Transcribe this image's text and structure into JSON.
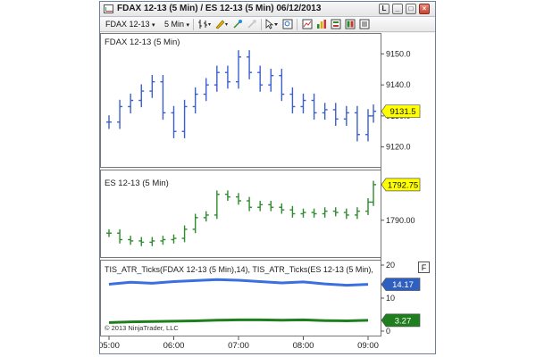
{
  "window": {
    "title": "FDAX 12-13 (5 Min) / ES 12-13 (5 Min)  06/12/2013",
    "buttons": [
      "L",
      "_",
      "□",
      "×"
    ]
  },
  "toolbar": {
    "instrument": "FDAX 12-13",
    "interval": "5 Min"
  },
  "panels": {
    "fdax": {
      "label": "FDAX 12-13 (5 Min)",
      "ticks": [
        "9150.0",
        "9140.0",
        "9130.0",
        "9120.0"
      ],
      "last_price": "9131.5",
      "color": "#3b5fcc"
    },
    "es": {
      "label": "ES 12-13 (5 Min)",
      "ticks": [
        "1790.00"
      ],
      "last_price": "1792.75",
      "color": "#2e8b2e"
    },
    "atr": {
      "label": "TIS_ATR_Ticks(FDAX 12-13 (5 Min),14), TIS_ATR_Ticks(ES 12-13 (5 Min),",
      "ticks": [
        "20",
        "10",
        "0"
      ],
      "value_blue": "14.17",
      "value_green": "3.27",
      "f_button": "F",
      "copyright": "© 2013 NinjaTrader, LLC"
    }
  },
  "time_axis": [
    "05:00",
    "06:00",
    "07:00",
    "08:00",
    "09:00"
  ],
  "chart_data": [
    {
      "type": "line",
      "title": "FDAX 12-13 (5 Min)",
      "x": [
        "05:00",
        "05:10",
        "05:20",
        "05:30",
        "05:40",
        "05:50",
        "06:00",
        "06:10",
        "06:20",
        "06:30",
        "06:40",
        "06:50",
        "07:00",
        "07:10",
        "07:20",
        "07:30",
        "07:40",
        "07:50",
        "08:00",
        "08:10",
        "08:20",
        "08:30",
        "08:40",
        "08:50",
        "09:00",
        "09:05"
      ],
      "series": [
        {
          "values": [
            9128,
            9133,
            9135,
            9138,
            9141,
            9131,
            9125,
            9133,
            9137,
            9140,
            9144,
            9141,
            9149,
            9144,
            9140,
            9143,
            9137,
            9133,
            9135,
            9131,
            9132,
            9129,
            9131,
            9124,
            9130,
            9131.5
          ]
        }
      ],
      "ylim": [
        9115,
        9155
      ]
    },
    {
      "type": "line",
      "title": "ES 12-13 (5 Min)",
      "x": [
        "05:00",
        "05:10",
        "05:20",
        "05:30",
        "05:40",
        "05:50",
        "06:00",
        "06:10",
        "06:20",
        "06:30",
        "06:40",
        "06:50",
        "07:00",
        "07:10",
        "07:20",
        "07:30",
        "07:40",
        "07:50",
        "08:00",
        "08:10",
        "08:20",
        "08:30",
        "08:40",
        "08:50",
        "09:00",
        "09:05"
      ],
      "series": [
        {
          "values": [
            1789.0,
            1788.5,
            1788.4,
            1788.3,
            1788.4,
            1788.5,
            1788.6,
            1789.3,
            1790.2,
            1790.4,
            1792.0,
            1791.8,
            1791.5,
            1791.0,
            1791.2,
            1791.0,
            1790.8,
            1790.5,
            1790.6,
            1790.5,
            1790.7,
            1790.6,
            1790.4,
            1790.7,
            1791.4,
            1792.75
          ]
        }
      ],
      "ylim": [
        1787.5,
        1793.5
      ]
    },
    {
      "type": "line",
      "title": "TIS_ATR_Ticks",
      "x": [
        "05:00",
        "05:20",
        "05:40",
        "06:00",
        "06:20",
        "06:40",
        "07:00",
        "07:20",
        "07:40",
        "08:00",
        "08:20",
        "08:40",
        "09:00"
      ],
      "series": [
        {
          "name": "TIS_ATR_Ticks(FDAX 12-13 (5 Min),14)",
          "values": [
            14.2,
            14.8,
            14.5,
            15.0,
            15.3,
            15.6,
            15.4,
            15.0,
            14.6,
            14.9,
            14.3,
            13.9,
            14.17
          ]
        },
        {
          "name": "TIS_ATR_Ticks(ES 12-13 (5 Min),",
          "values": [
            2.6,
            2.8,
            2.9,
            3.0,
            3.1,
            3.3,
            3.4,
            3.4,
            3.3,
            3.4,
            3.2,
            3.1,
            3.27
          ]
        }
      ],
      "ylim": [
        0,
        20
      ]
    }
  ]
}
